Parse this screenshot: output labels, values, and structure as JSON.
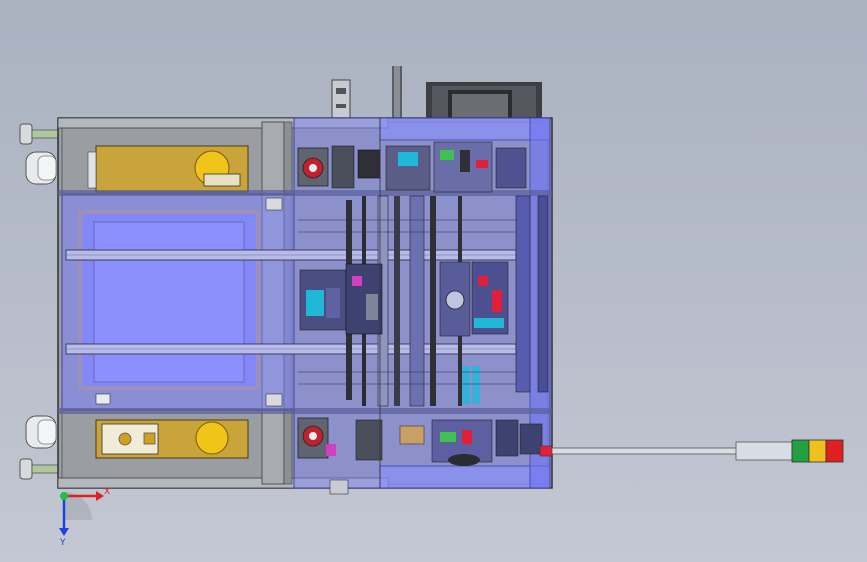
{
  "viewport": {
    "background_top": "#aab1c0",
    "background_bottom": "#c3c8d2"
  },
  "machine": {
    "frame_color": "#8e9196",
    "frame_dark": "#3a3c40",
    "enclosure_color": "#7d83ff",
    "enclosure_opacity": 0.55,
    "plate_color": "#c9a43a",
    "wood_color": "#c8a064",
    "accent_red": "#e0203a",
    "accent_cyan": "#20b8d8",
    "accent_green": "#40c050",
    "accent_magenta": "#d040c0"
  },
  "signal_tower": {
    "lamps": [
      {
        "color": "#20a040"
      },
      {
        "color": "#f0c020"
      },
      {
        "color": "#e02020"
      }
    ],
    "arm_color": "#d8dce4"
  },
  "triad": {
    "x_label": "X",
    "y_label": "Y",
    "x_color": "#e02020",
    "y_color": "#2040e0",
    "origin_color": "#20c040"
  }
}
